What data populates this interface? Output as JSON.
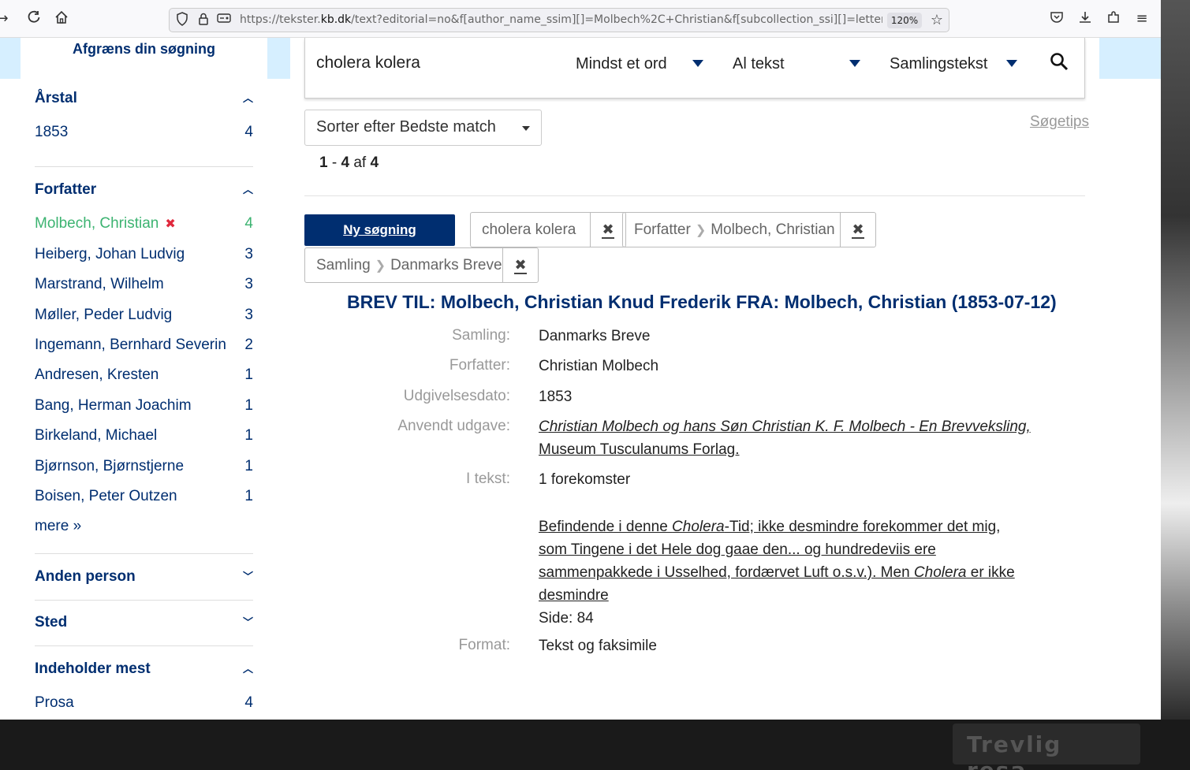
{
  "browser": {
    "url_prefix": "https://tekster.",
    "url_domain": "kb.dk",
    "url_rest": "/text?editorial=no&f[author_name_ssim][]=Molbech%2C+Christian&f[subcollection_ssi][]=letter",
    "zoom": "120%"
  },
  "sidebar": {
    "title": "Afgræns din søgning",
    "arstal": {
      "heading": "Årstal",
      "items": [
        {
          "label": "1853",
          "count": "4"
        }
      ]
    },
    "forfatter": {
      "heading": "Forfatter",
      "selected": {
        "label": "Molbech, Christian",
        "count": "4"
      },
      "items": [
        {
          "label": "Heiberg, Johan Ludvig",
          "count": "3"
        },
        {
          "label": "Marstrand, Wilhelm",
          "count": "3"
        },
        {
          "label": "Møller, Peder Ludvig",
          "count": "3"
        },
        {
          "label": "Ingemann, Bernhard Severin",
          "count": "2"
        },
        {
          "label": "Andresen, Kresten",
          "count": "1"
        },
        {
          "label": "Bang, Herman Joachim",
          "count": "1"
        },
        {
          "label": "Birkeland, Michael",
          "count": "1"
        },
        {
          "label": "Bjørnson, Bjørnstjerne",
          "count": "1"
        },
        {
          "label": "Boisen, Peter Outzen",
          "count": "1"
        }
      ],
      "more": "mere »"
    },
    "anden_person": {
      "heading": "Anden person"
    },
    "sted": {
      "heading": "Sted"
    },
    "indeholder": {
      "heading": "Indeholder mest",
      "items": [
        {
          "label": "Prosa",
          "count": "4"
        }
      ]
    }
  },
  "search": {
    "query": "cholera kolera",
    "operator": "Mindst et ord",
    "field": "Al tekst",
    "collection": "Samlingstekst"
  },
  "sort": {
    "label": "Sorter efter Bedste match"
  },
  "tips": "Søgetips",
  "results": {
    "from": "1",
    "to": "4",
    "of_word": "af",
    "total": "4",
    "dash": " - "
  },
  "constraints": {
    "new_search": "Ny søgning",
    "query_chip": "cholera kolera",
    "author_field": "Forfatter",
    "author_value": "Molbech, Christian",
    "collection_field": "Samling",
    "collection_value": "Danmarks Breve"
  },
  "result": {
    "title": "BREV TIL: Molbech, Christian Knud Frederik FRA: Molbech, Christian (1853-07-12)",
    "labels": {
      "samling": "Samling:",
      "forfatter": "Forfatter:",
      "dato": "Udgivelsesdato:",
      "udgave": "Anvendt udgave:",
      "itekst": "I tekst:",
      "format": "Format:"
    },
    "samling": "Danmarks Breve",
    "forfatter": "Christian Molbech",
    "dato": "1853",
    "udgave_line1": "Christian Molbech og hans Søn Christian K. F. Molbech - En Brevveksling,",
    "udgave_line2": "Museum Tusculanums Forlag.",
    "occurrences": "1 forekomster",
    "snippet": {
      "part1": "Befindende i denne ",
      "hit1": "Cholera",
      "part2": "-Tid; ikke desmindre forekommer det mig, som Tingene i det Hele dog gaae den... og hundredeviis ere sammenpakkede i Usselhed, fordærvet Luft o.s.v.). Men ",
      "hit2": "Cholera",
      "part3": " er ikke desmindre"
    },
    "page": "Side: 84",
    "format": "Tekst og faksimile"
  },
  "desktop": {
    "sign_text": "Trevlig resa"
  }
}
